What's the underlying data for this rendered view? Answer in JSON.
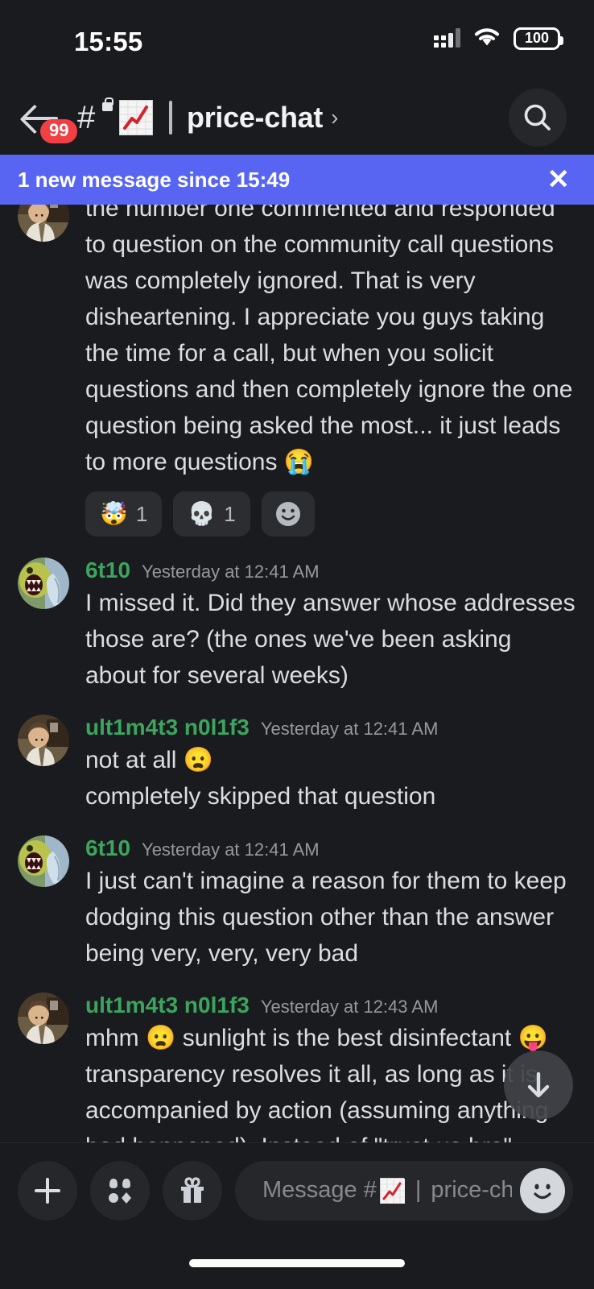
{
  "status_bar": {
    "time": "15:55",
    "battery_level": "100",
    "signal_icon": "cellular-signal-icon",
    "wifi_icon": "wifi-icon",
    "battery_icon": "battery-icon"
  },
  "header": {
    "back_icon": "back-arrow-icon",
    "unread_badge": "99",
    "channel_type_icon": "private-channel-hash-lock-icon",
    "channel_emoji": "chart-increasing-emoji",
    "channel_name": "price-chat",
    "chevron": "›",
    "search_icon": "search-icon"
  },
  "banner": {
    "text": "1 new message since 15:49",
    "close_label": "✕"
  },
  "messages": [
    {
      "author": "",
      "timestamp": "",
      "avatar": "dwight-office-avatar",
      "clipped_top": true,
      "text": "the number one commented and responded to question on the community call questions was completely ignored. That is very disheartening. I appreciate you guys taking the time for a call, but when you solicit questions and then completely ignore the one question being asked the most... it just leads to more questions 😭",
      "reactions": [
        {
          "emoji": "🤯",
          "count": "1",
          "name": "exploding-head-reaction"
        },
        {
          "emoji": "💀",
          "count": "1",
          "name": "skull-reaction"
        },
        {
          "emoji": "add",
          "count": "",
          "name": "add-reaction-button"
        }
      ]
    },
    {
      "author": "6t10",
      "timestamp": "Yesterday at 12:41 AM",
      "avatar": "monster-creature-avatar",
      "text": "I missed it. Did they answer whose addresses those are? (the ones we've been asking about for several weeks)",
      "reactions": []
    },
    {
      "author": "ult1m4t3 n0l1f3",
      "timestamp": "Yesterday at 12:41 AM",
      "avatar": "dwight-office-avatar",
      "text": "not at all 😦",
      "extra_line": "completely skipped that question",
      "reactions": []
    },
    {
      "author": "6t10",
      "timestamp": "Yesterday at 12:41 AM",
      "avatar": "monster-creature-avatar",
      "text": "I just can't imagine a reason for them to keep dodging this question other than the answer being very, very, very bad",
      "reactions": []
    },
    {
      "author": "ult1m4t3 n0l1f3",
      "timestamp": "Yesterday at 12:43 AM",
      "avatar": "dwight-office-avatar",
      "clipped_bottom": true,
      "text": "mhm 😦 sunlight is the best disinfectant 😛 transparency resolves it all, as long as it is accompanied by action (assuming anything bad happened). Instead of \"trust us bro\"... they could just put it on the table and show us why its all the up and up",
      "reactions": []
    }
  ],
  "jump_button": {
    "icon": "arrow-down-icon"
  },
  "composer": {
    "add_icon": "plus-icon",
    "sticker_icon": "sticker-icon",
    "gift_icon": "gift-icon",
    "placeholder_prefix": "Message #",
    "placeholder_emoji": "chart-increasing-emoji",
    "placeholder_divider": "|",
    "placeholder_channel": "price-chat",
    "emoji_icon": "emoji-smiley-icon"
  },
  "home_indicator": "home-indicator",
  "colors": {
    "background": "#1a1b1e",
    "banner": "#5865f2",
    "username": "#3ba55d",
    "text": "#dbdee1",
    "muted": "#96989d",
    "badge_red": "#f23f43",
    "surface": "#26272b"
  }
}
